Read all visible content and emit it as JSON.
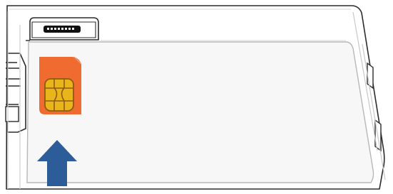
{
  "illustration": {
    "device": "router-bottom-panel",
    "connector": "sim-card-slot-connector",
    "card": "sim-card",
    "chip": "sim-chip",
    "direction_indicator": "up-arrow"
  },
  "colors": {
    "outline": "#2c2c2c",
    "panel_fill": "#f7f7f7",
    "panel_border": "#b7b7b7",
    "sim_card": "#ef6b2f",
    "sim_chip": "#e8b61a",
    "sim_chip_line": "#8f5a10",
    "arrow": "#2d5d98",
    "connector": "#111111",
    "connector_highlight": "#f5f5f5"
  }
}
